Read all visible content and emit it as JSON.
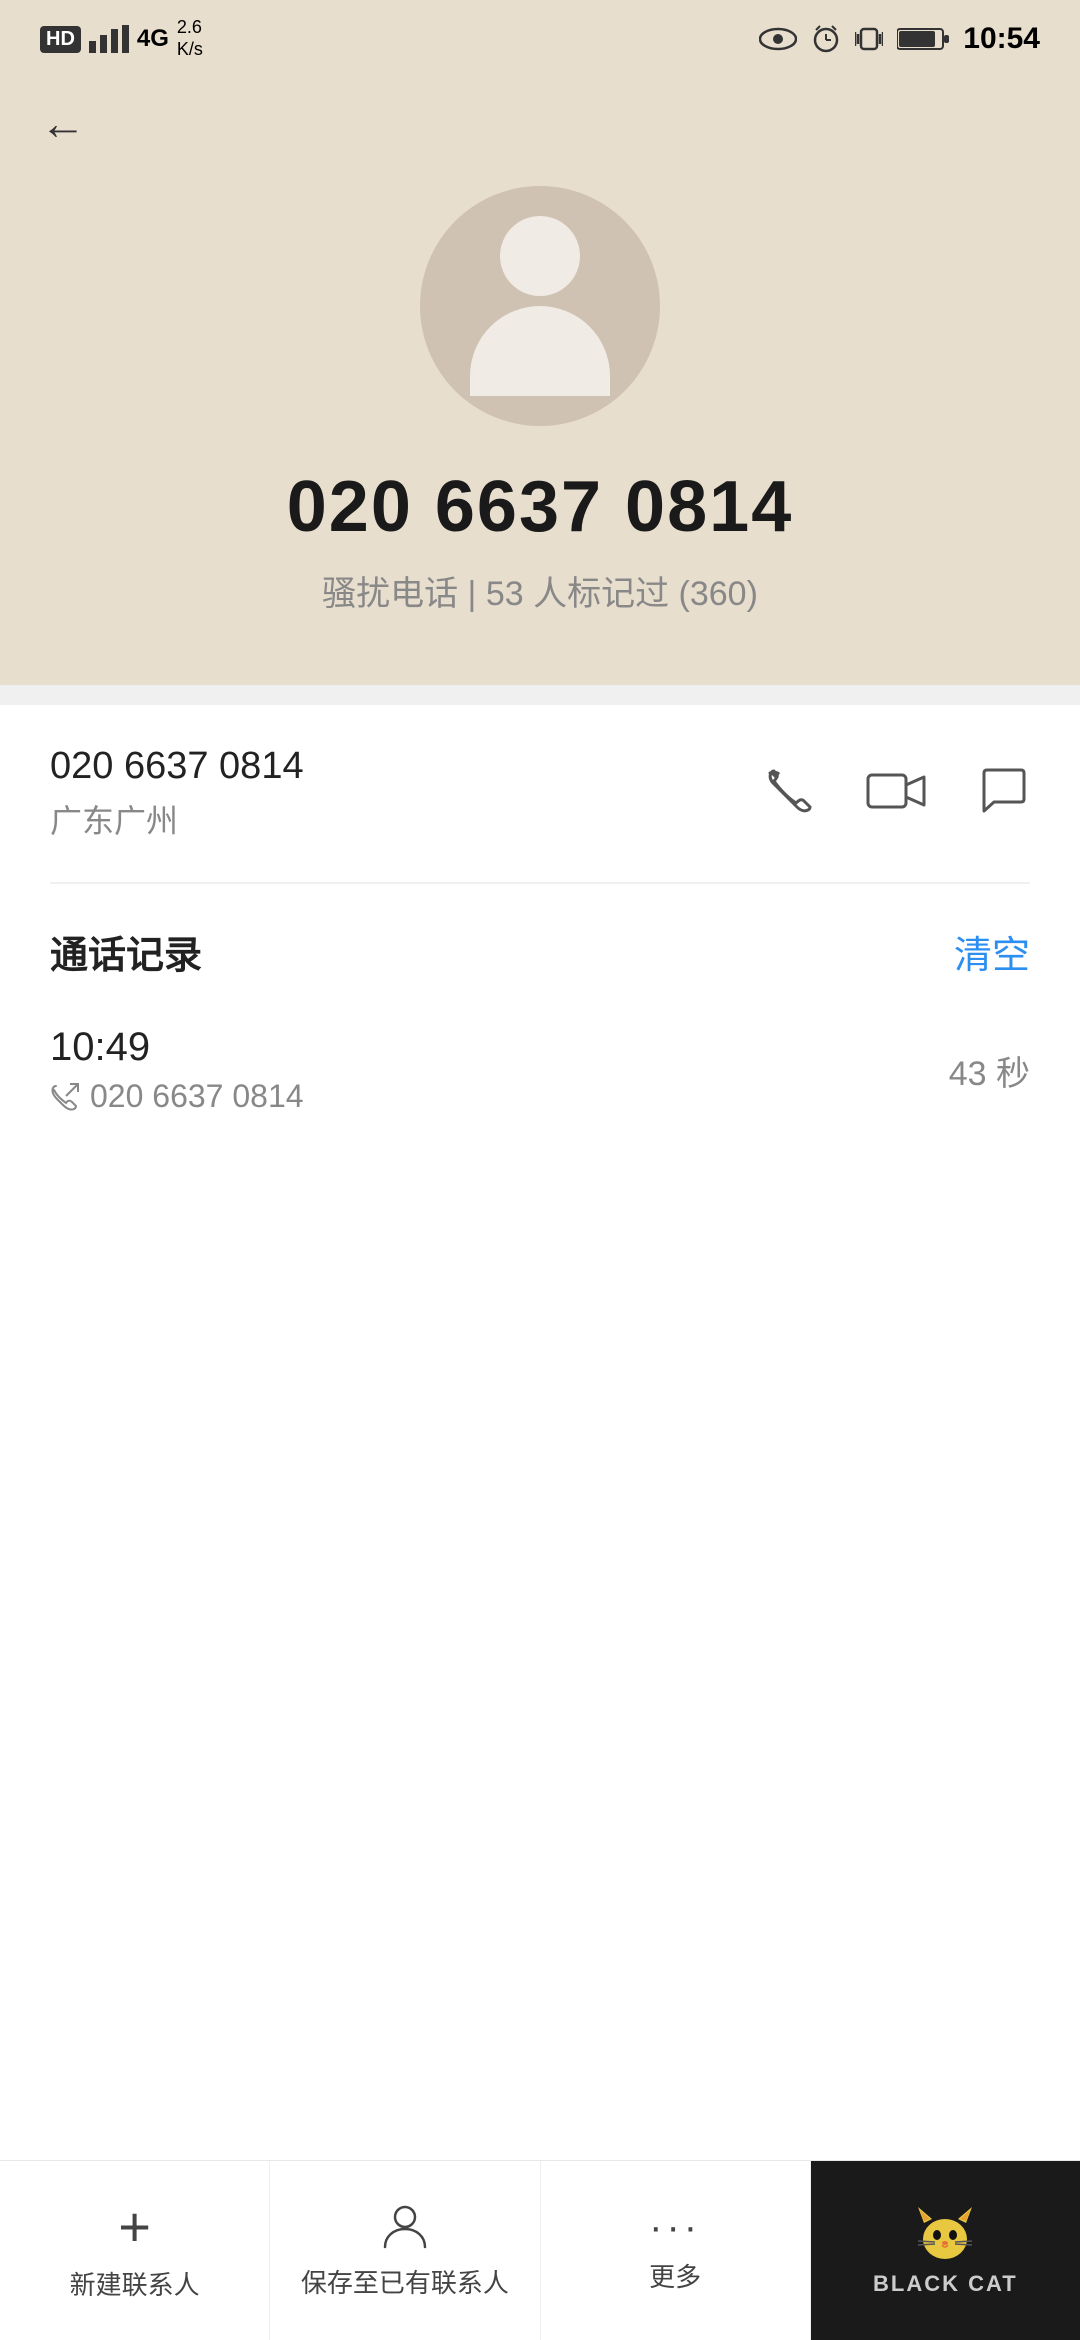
{
  "statusBar": {
    "left": {
      "hd": "HD",
      "signal": "4G",
      "speed": "2.6\nK/s"
    },
    "right": {
      "time": "10:54"
    }
  },
  "profile": {
    "phoneNumber": "020 6637 0814",
    "tag": "骚扰电话 | 53 人标记过 (360)"
  },
  "contactRow": {
    "number": "020 6637 0814",
    "location": "广东广州"
  },
  "callHistory": {
    "title": "通话记录",
    "clearLabel": "清空",
    "entries": [
      {
        "time": "10:49",
        "number": "020 6637 0814",
        "duration": "43 秒"
      }
    ]
  },
  "bottomNav": {
    "items": [
      {
        "icon": "+",
        "label": "新建联系人"
      },
      {
        "icon": "person",
        "label": "保存至已有联系人"
      },
      {
        "icon": "more",
        "label": "更多"
      },
      {
        "icon": "blackcat",
        "label": "BLACK CAT"
      }
    ]
  }
}
